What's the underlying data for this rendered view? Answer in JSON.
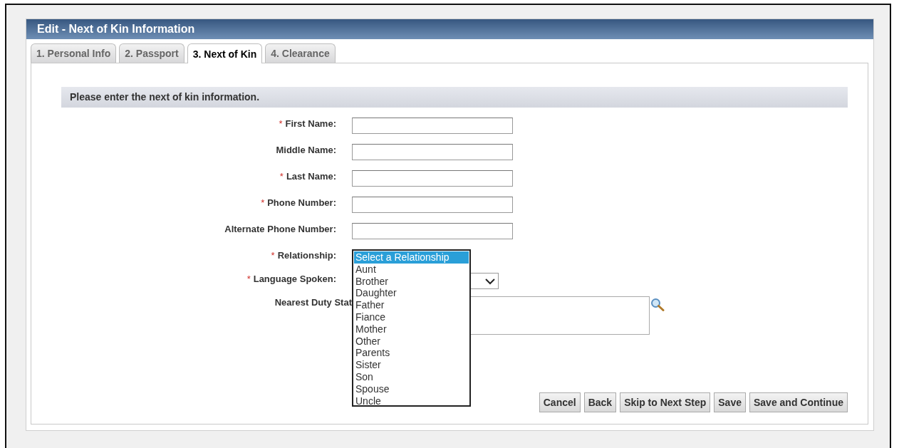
{
  "window": {
    "title": "Edit - Next of Kin Information"
  },
  "tabs": [
    {
      "label": "1. Personal Info",
      "selected": false
    },
    {
      "label": "2. Passport",
      "selected": false
    },
    {
      "label": "3. Next of Kin",
      "selected": true
    },
    {
      "label": "4. Clearance",
      "selected": false
    }
  ],
  "section": {
    "title": "Please enter the next of kin information."
  },
  "fields": [
    {
      "kind": "text",
      "label": "First Name:",
      "required_mark": "*"
    },
    {
      "kind": "text",
      "label": "Middle Name:"
    },
    {
      "kind": "text",
      "label": "Last Name:",
      "required_mark": "*"
    },
    {
      "kind": "text",
      "label": "Phone Number:",
      "required_mark": "*"
    },
    {
      "kind": "text",
      "label": "Alternate Phone Number:"
    },
    {
      "kind": "listbox",
      "label": "Relationship:",
      "required_mark": "*",
      "options": [
        {
          "label": "Select a Relationship",
          "selected": true
        },
        {
          "label": "Aunt",
          "selected": false
        },
        {
          "label": "Brother",
          "selected": false
        },
        {
          "label": "Daughter",
          "selected": false
        },
        {
          "label": "Father",
          "selected": false
        },
        {
          "label": "Fiance",
          "selected": false
        },
        {
          "label": "Mother",
          "selected": false
        },
        {
          "label": "Other",
          "selected": false
        },
        {
          "label": "Parents",
          "selected": false
        },
        {
          "label": "Sister",
          "selected": false
        },
        {
          "label": "Son",
          "selected": false
        },
        {
          "label": "Spouse",
          "selected": false
        },
        {
          "label": "Uncle",
          "selected": false
        }
      ]
    },
    {
      "kind": "select",
      "label": "Language Spoken:",
      "required_mark": "*"
    },
    {
      "kind": "lookup",
      "label": "Nearest Duty Stat"
    }
  ],
  "buttons": [
    "Cancel",
    "Back",
    "Skip to Next Step",
    "Save",
    "Save and Continue"
  ]
}
